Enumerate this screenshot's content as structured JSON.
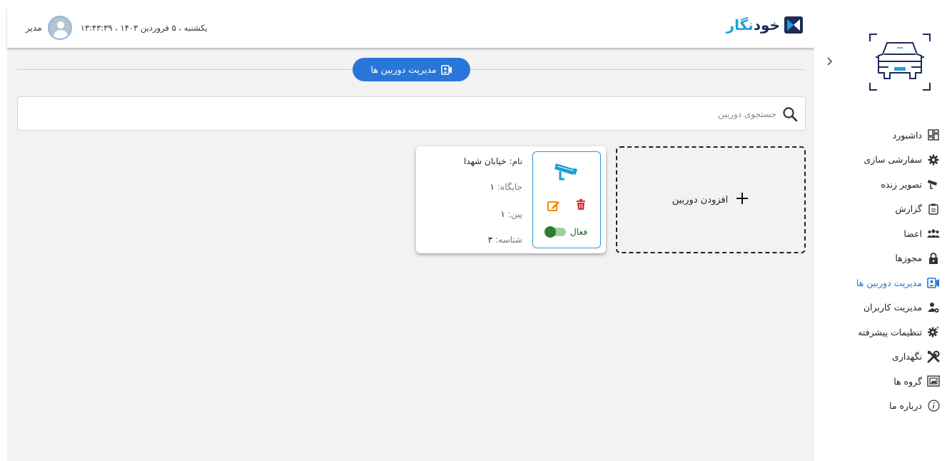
{
  "header": {
    "user_name": "مدیر",
    "datetime": "یکشنبه ، ۵ فروردین ۱۴۰۳ ، ۱۳:۴۳:۳۹",
    "logo_part1": "خود",
    "logo_part2": "نگار"
  },
  "page": {
    "title": "مدیریت دوربین ها"
  },
  "search": {
    "placeholder": "جستجوی دوربین",
    "value": ""
  },
  "add_card": {
    "label": "افزودن دوربین"
  },
  "cameras": [
    {
      "name_label": "نام:",
      "name": "خیابان شهدا",
      "slot_label": "جایگاه:",
      "slot": "۱",
      "pin_label": "پین:",
      "pin": "۱",
      "id_label": "شناسه:",
      "id": "۳",
      "status_label": "فعال",
      "active": true
    }
  ],
  "sidebar": {
    "items": [
      {
        "label": "داشبورد",
        "icon": "dashboard-icon"
      },
      {
        "label": "سفارشی سازی",
        "icon": "gear-icon"
      },
      {
        "label": "تصویر زنده",
        "icon": "cctv-icon"
      },
      {
        "label": "گزارش",
        "icon": "clipboard-icon"
      },
      {
        "label": "اعضا",
        "icon": "group-icon"
      },
      {
        "label": "مجوزها",
        "icon": "lock-icon"
      },
      {
        "label": "مدیریت دوربین ها",
        "icon": "camera-account-icon",
        "active": true
      },
      {
        "label": "مدیریت کاربران",
        "icon": "user-cog-icon"
      },
      {
        "label": "تنظیمات پیشرفته",
        "icon": "advanced-gear-icon"
      },
      {
        "label": "نگهداری",
        "icon": "tools-icon"
      },
      {
        "label": "گروه ها",
        "icon": "image-frame-icon"
      },
      {
        "label": "درباره ما",
        "icon": "info-icon"
      }
    ]
  },
  "colors": {
    "accent": "#2976d9",
    "logo_dark": "#1e2b58",
    "logo_light": "#1ea0dc",
    "edit": "#f08c00",
    "delete": "#d32f2f",
    "active": "#2e7d32"
  }
}
